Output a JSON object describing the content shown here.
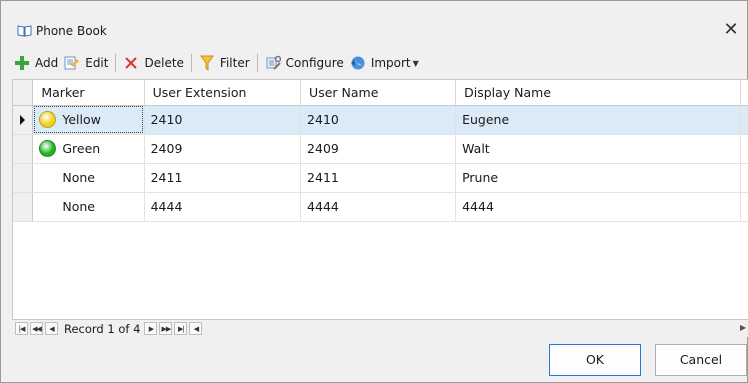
{
  "window": {
    "title": "Phone Book",
    "close_glyph": "✕"
  },
  "toolbar": {
    "add_label": "Add",
    "edit_label": "Edit",
    "delete_label": "Delete",
    "filter_label": "Filter",
    "configure_label": "Configure",
    "import_label": "Import"
  },
  "grid": {
    "columns": [
      "Marker",
      "User Extension",
      "User Name",
      "Display Name"
    ],
    "rows": [
      {
        "marker": "Yellow",
        "marker_color": "#f2d21b",
        "extension": "2410",
        "user_name": "2410",
        "display_name": "Eugene",
        "selected": true
      },
      {
        "marker": "Green",
        "marker_color": "#21b321",
        "extension": "2409",
        "user_name": "2409",
        "display_name": "Walt",
        "selected": false
      },
      {
        "marker": "None",
        "marker_color": "",
        "extension": "2411",
        "user_name": "2411",
        "display_name": "Prune",
        "selected": false
      },
      {
        "marker": "None",
        "marker_color": "",
        "extension": "4444",
        "user_name": "4444",
        "display_name": "4444",
        "selected": false
      }
    ]
  },
  "navigator": {
    "record_text": "Record 1 of 4"
  },
  "buttons": {
    "ok_label": "OK",
    "cancel_label": "Cancel"
  },
  "colors": {
    "selected_row": "#dbeaf7",
    "ok_border": "#2b79d4"
  }
}
